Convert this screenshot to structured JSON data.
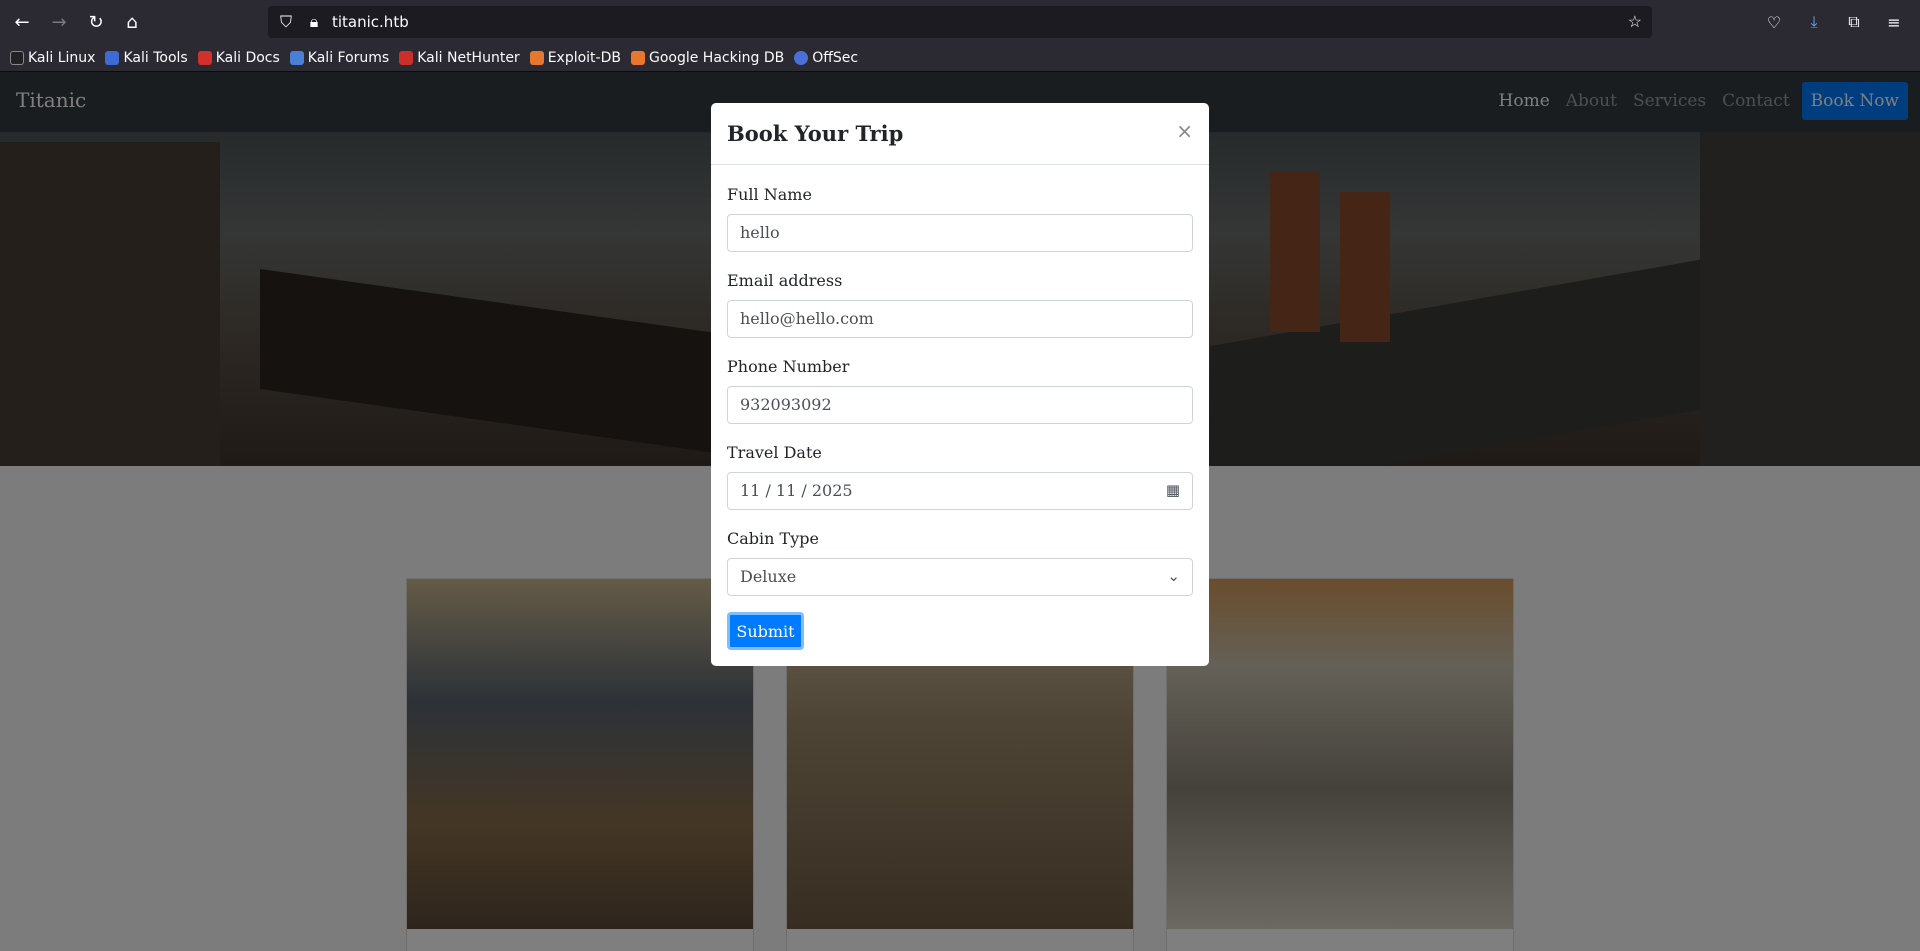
{
  "browser": {
    "url": "titanic.htb",
    "bookmarks": [
      "Kali Linux",
      "Kali Tools",
      "Kali Docs",
      "Kali Forums",
      "Kali NetHunter",
      "Exploit-DB",
      "Google Hacking DB",
      "OffSec"
    ]
  },
  "site": {
    "brand": "Titanic",
    "nav": [
      "Home",
      "About",
      "Services",
      "Contact"
    ],
    "book_now": "Book Now"
  },
  "modal": {
    "title": "Book Your Trip",
    "close": "×",
    "fields": {
      "name": {
        "label": "Full Name",
        "value": "hello"
      },
      "email": {
        "label": "Email address",
        "value": "hello@hello.com"
      },
      "phone": {
        "label": "Phone Number",
        "value": "932093092"
      },
      "date": {
        "label": "Travel Date",
        "value": "11 / 11 / 2025"
      },
      "cabin": {
        "label": "Cabin Type",
        "value": "Deluxe"
      }
    },
    "submit": "Submit"
  },
  "colors": {
    "accent": "#007bff",
    "navbar": "#343a40"
  }
}
